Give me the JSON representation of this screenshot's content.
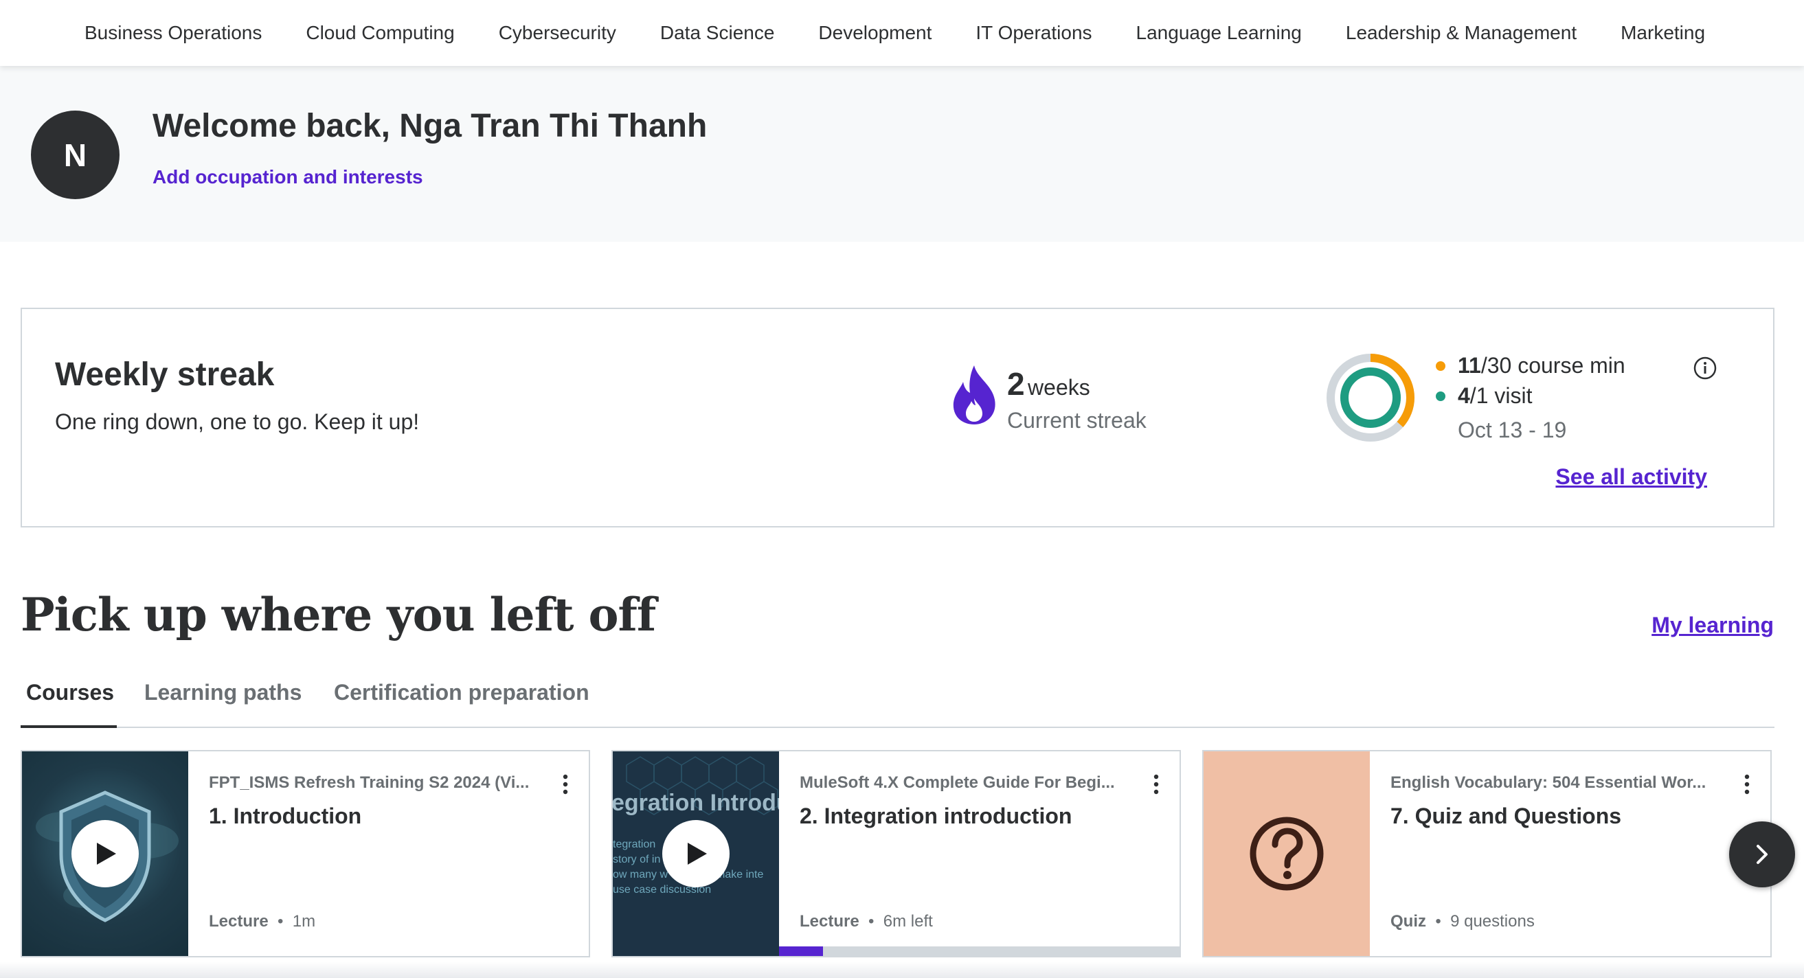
{
  "nav": {
    "items": [
      "Business Operations",
      "Cloud Computing",
      "Cybersecurity",
      "Data Science",
      "Development",
      "IT Operations",
      "Language Learning",
      "Leadership & Management",
      "Marketing"
    ]
  },
  "welcome": {
    "avatar_letter": "N",
    "title": "Welcome back, Nga Tran Thi Thanh",
    "link": "Add occupation and interests"
  },
  "streak": {
    "title": "Weekly streak",
    "subtitle": "One ring down, one to go. Keep it up!",
    "weeks_value": "2",
    "weeks_unit": "weeks",
    "weeks_label": "Current streak",
    "course_min_value": "11",
    "course_min_rest": "/30 course min",
    "course_min_fraction": 0.367,
    "visit_value": "4",
    "visit_rest": "/1 visit",
    "visit_fraction": 1.0,
    "date_range": "Oct 13 - 19",
    "see_all": "See all activity",
    "colors": {
      "course_min": "#f69c08",
      "visit": "#1e9c81",
      "track": "#d1d7dc",
      "flame": "#5624d0"
    }
  },
  "pickup": {
    "title": "Pick up where you left off",
    "my_learning": "My learning",
    "tabs": [
      "Courses",
      "Learning paths",
      "Certification preparation"
    ],
    "active_tab": 0
  },
  "cards": [
    {
      "kicker": "FPT_ISMS Refresh Training S2 2024 (Vi...",
      "title": "1. Introduction",
      "type": "Lecture",
      "detail": "1m",
      "thumb": "shield-video",
      "progress": null
    },
    {
      "kicker": "MuleSoft 4.X Complete Guide For Begi...",
      "title": "2. Integration introduction",
      "type": "Lecture",
      "detail": "6m left",
      "thumb": "integration-video",
      "progress": 0.11
    },
    {
      "kicker": "English Vocabulary: 504 Essential Wor...",
      "title": "7. Quiz and Questions",
      "type": "Quiz",
      "detail": "9 questions",
      "thumb": "question-icon",
      "progress": null
    }
  ]
}
